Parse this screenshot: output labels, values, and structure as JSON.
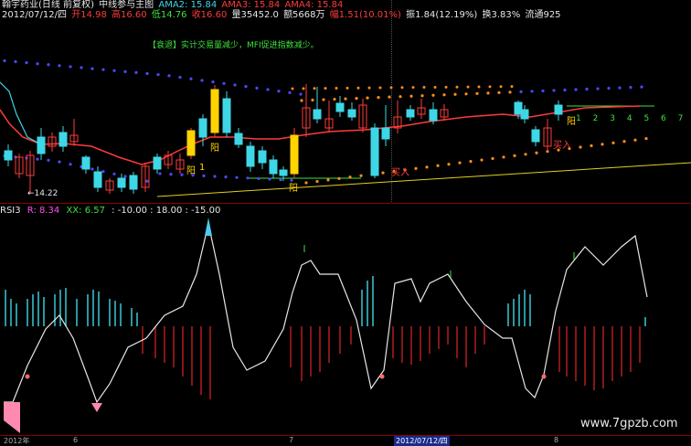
{
  "header": {
    "title": "翰宇药业(日线 前复权)",
    "subtitle": "中线参与主图",
    "ama2": "AMA2: 15.84",
    "ama3": "AMA3: 15.84",
    "ama4": "AMA4: 15.84",
    "date": "2012/07/12/四",
    "open": "开14.98",
    "high": "高16.60",
    "low": "低14.76",
    "close": "收16.60",
    "volume": "量35452.0",
    "amount": "额5668万",
    "change": "幅1.51(10.01%)",
    "amplitude": "振1.84(12.19%)",
    "turnover": "换3.83%",
    "float": "流通925"
  },
  "note": "【衰退】实计交易量减少，MFI促进指数减少。",
  "labels": {
    "yang1": "阳",
    "yang2": "阳",
    "yang3": "阳",
    "yang4": "阳",
    "num1": "1",
    "buy1": "买入",
    "buy2": "买入",
    "lowprice": "14.22",
    "seq": [
      "1",
      "2",
      "3",
      "4",
      "5",
      "6",
      "7"
    ]
  },
  "rsi": {
    "name": "RSI3",
    "r": "R: 8.34",
    "xx": "XX: 6.57",
    "lv1": ": -10.00",
    "lv2": ": 18.00",
    "lv3": ": -15.00"
  },
  "xaxis": {
    "l0": "2012年",
    "l1": "6",
    "l2": "7",
    "l3": "2012/07/12/四",
    "l4": "8"
  },
  "watermark": "www.7gpzb.com",
  "colors": {
    "up": "#ff3b3b",
    "down": "#3ed7e6",
    "ama": "#ff3b3b",
    "band_upper": "#ff8c1a",
    "band_lower": "#4a4aff"
  }
}
